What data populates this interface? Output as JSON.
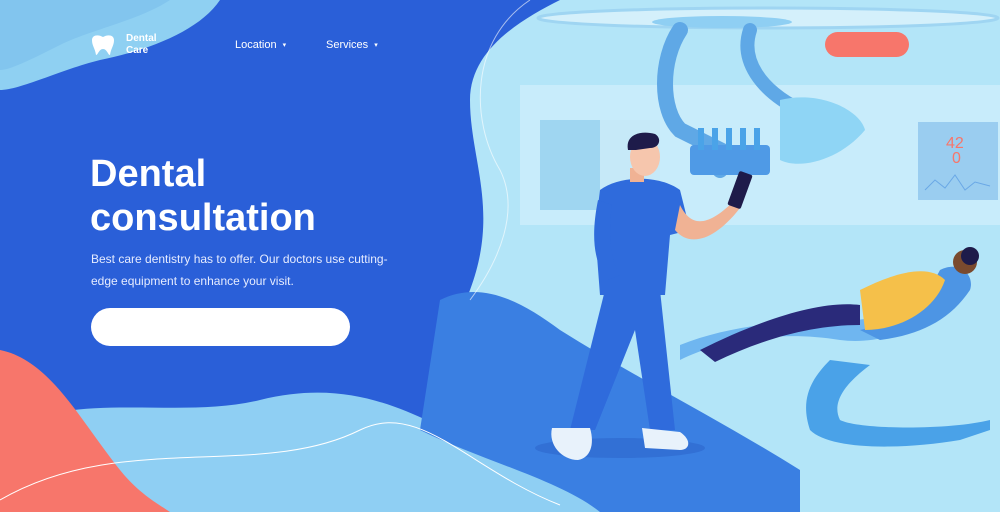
{
  "brand": {
    "line1": "Dental",
    "line2": "Care",
    "icon": "tooth-icon"
  },
  "nav": [
    {
      "label": "Location",
      "caret": "▾"
    },
    {
      "label": "Services",
      "caret": "▾"
    }
  ],
  "top_cta": {
    "label": ""
  },
  "hero": {
    "title_line1": "Dental",
    "title_line2": "consultation",
    "subtitle": "Best care dentistry has to offer. Our doctors use cutting-edge equipment to enhance your visit.",
    "input_placeholder": ""
  },
  "monitor": {
    "value1": "42",
    "value2": "0"
  },
  "colors": {
    "primary_blue": "#2a5fd8",
    "light_blue": "#a9e0f7",
    "coral": "#f7766b",
    "scrub_blue": "#2f6bdc",
    "patient_yellow": "#f5c04a"
  }
}
